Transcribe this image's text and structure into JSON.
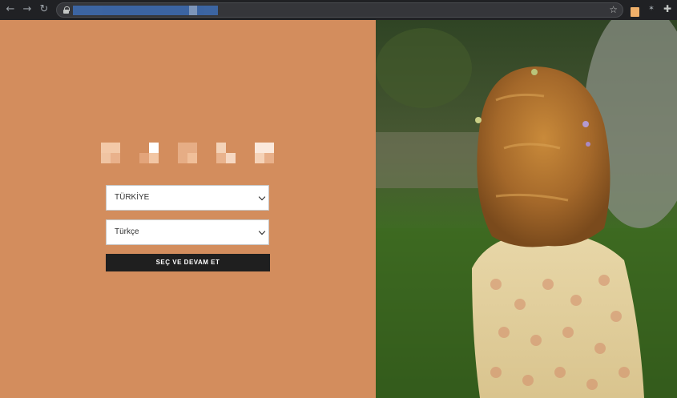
{
  "browser": {
    "back_icon": "arrow-left-icon",
    "forward_icon": "arrow-right-icon",
    "reload_icon": "reload-icon",
    "bookmark_icon": "star-icon",
    "extension_icon": "puzzle-icon"
  },
  "selector": {
    "country": {
      "value": "TÜRKİYE"
    },
    "language": {
      "value": "Türkçe"
    },
    "continue_label": "SEÇ VE DEVAM ET"
  },
  "colors": {
    "panel_background": "#d38d5d",
    "button_background": "#1f1f1f"
  }
}
